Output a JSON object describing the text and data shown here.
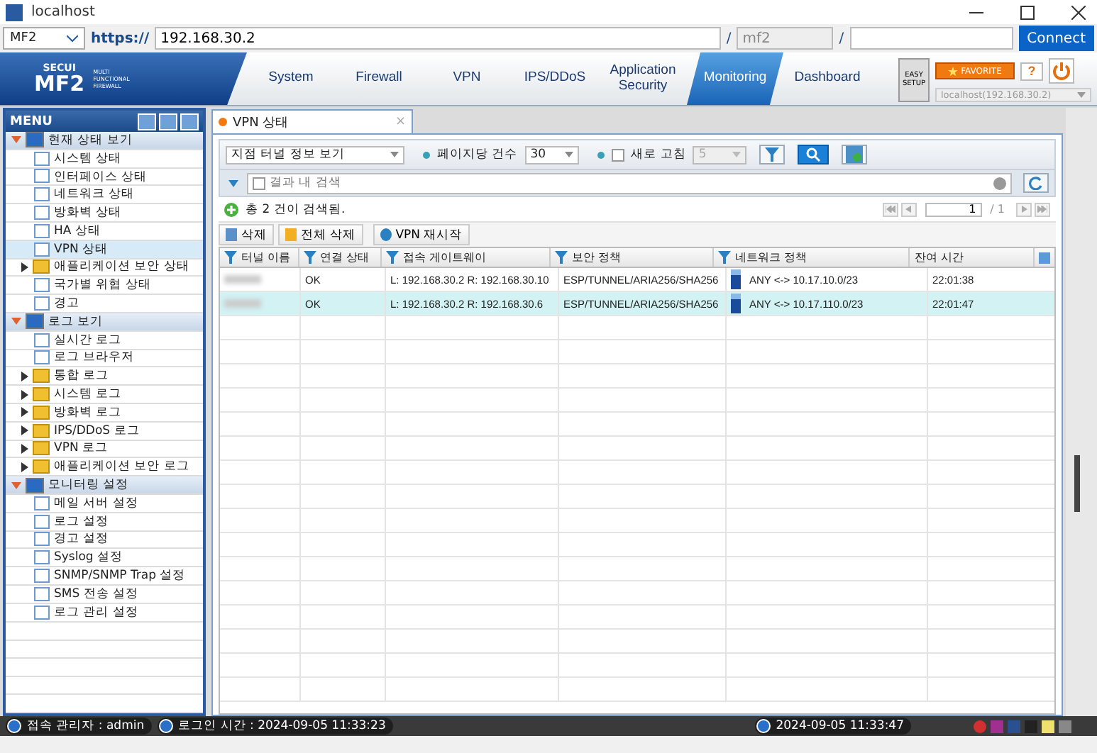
{
  "window": {
    "title": "localhost"
  },
  "address_bar": {
    "device": "MF2",
    "scheme": "https://",
    "host": "192.168.30.2",
    "separator_1": "/",
    "user": "mf2",
    "separator_2": "/",
    "connect": "Connect"
  },
  "header": {
    "logo_top": "SECUI",
    "logo_main": "MF2",
    "logo_sub": "MULTI FUNCTIONAL FIREWALL",
    "tabs": [
      {
        "label": "System",
        "selected": false
      },
      {
        "label": "Firewall",
        "selected": false
      },
      {
        "label": "VPN",
        "selected": false
      },
      {
        "label": "IPS/DDoS",
        "selected": false
      },
      {
        "label": "Application Security",
        "selected": false
      },
      {
        "label": "Monitoring",
        "selected": true
      },
      {
        "label": "Dashboard",
        "selected": false
      }
    ],
    "easy_setup": "EASY SETUP",
    "favorite": "FAVORITE",
    "help": "?",
    "host_select": "localhost(192.168.30.2)"
  },
  "sidebar": {
    "title": "MENU",
    "groups": [
      {
        "label": "현재 상태 보기",
        "expanded": true,
        "children": [
          {
            "label": "시스템 상태",
            "kind": "page",
            "selected": false
          },
          {
            "label": "인터페이스 상태",
            "kind": "page",
            "selected": false
          },
          {
            "label": "네트워크 상태",
            "kind": "page",
            "selected": false
          },
          {
            "label": "방화벽 상태",
            "kind": "page",
            "selected": false
          },
          {
            "label": "HA 상태",
            "kind": "page",
            "selected": false
          },
          {
            "label": "VPN 상태",
            "kind": "page",
            "selected": true
          },
          {
            "label": "애플리케이션 보안 상태",
            "kind": "folder",
            "selected": false
          },
          {
            "label": "국가별 위협 상태",
            "kind": "page",
            "selected": false
          },
          {
            "label": "경고",
            "kind": "page",
            "selected": false
          }
        ]
      },
      {
        "label": "로그 보기",
        "expanded": true,
        "children": [
          {
            "label": "실시간 로그",
            "kind": "page",
            "selected": false
          },
          {
            "label": "로그 브라우저",
            "kind": "page",
            "selected": false
          },
          {
            "label": "통합 로그",
            "kind": "folder",
            "selected": false
          },
          {
            "label": "시스템 로그",
            "kind": "folder",
            "selected": false
          },
          {
            "label": "방화벽 로그",
            "kind": "folder",
            "selected": false
          },
          {
            "label": "IPS/DDoS 로그",
            "kind": "folder",
            "selected": false
          },
          {
            "label": "VPN 로그",
            "kind": "folder",
            "selected": false
          },
          {
            "label": "애플리케이션 보안 로그",
            "kind": "folder",
            "selected": false
          }
        ]
      },
      {
        "label": "모니터링 설정",
        "expanded": true,
        "children": [
          {
            "label": "메일 서버 설정",
            "kind": "page",
            "selected": false
          },
          {
            "label": "로그 설정",
            "kind": "page",
            "selected": false
          },
          {
            "label": "경고 설정",
            "kind": "page",
            "selected": false
          },
          {
            "label": "Syslog 설정",
            "kind": "page",
            "selected": false
          },
          {
            "label": "SNMP/SNMP Trap 설정",
            "kind": "page",
            "selected": false
          },
          {
            "label": "SMS 전송 설정",
            "kind": "page",
            "selected": false
          },
          {
            "label": "로그 관리 설정",
            "kind": "page",
            "selected": false
          }
        ]
      }
    ]
  },
  "content_tab": {
    "label": "VPN 상태",
    "close": "×"
  },
  "toolbar": {
    "view_select": "지점 터널 정보 보기",
    "page_size_label": "페이지당 건수",
    "page_size": "30",
    "refresh_checked": false,
    "refresh_label": "새로 고침",
    "refresh_interval": "5"
  },
  "search": {
    "placeholder": "결과 내 검색",
    "checked": false
  },
  "result": {
    "summary": "총 2 건이 검색됨.",
    "page": "1",
    "page_total": "/ 1"
  },
  "actions": [
    "삭제",
    "전체 삭제",
    "VPN 재시작"
  ],
  "table": {
    "columns": [
      "터널 이름",
      "연결 상태",
      "접속 게이트웨이",
      "보안 정책",
      "네트워크 정책",
      "잔여 시간"
    ],
    "rows": [
      {
        "status": "OK",
        "gateway": "L: 192.168.30.2 R: 192.168.30.10",
        "policy": "ESP/TUNNEL/ARIA256/SHA256",
        "network": "ANY <-> 10.17.10.0/23",
        "remaining": "22:01:38",
        "selected": false
      },
      {
        "status": "OK",
        "gateway": "L: 192.168.30.2 R: 192.168.30.6",
        "policy": "ESP/TUNNEL/ARIA256/SHA256",
        "network": "ANY <-> 10.17.110.0/23",
        "remaining": "22:01:47",
        "selected": true
      }
    ]
  },
  "status_bar": {
    "admin": "접속 관리자 : admin",
    "login_time": "로그인 시간 : 2024-09-05 11:33:23",
    "clock": "2024-09-05 11:33:47"
  }
}
